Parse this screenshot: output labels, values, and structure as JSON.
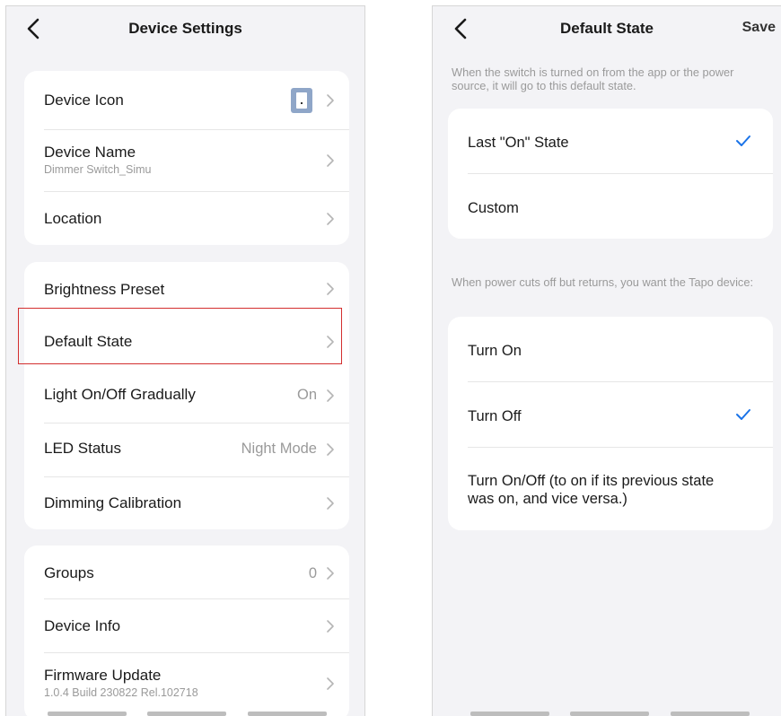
{
  "left_screen": {
    "nav": {
      "title": "Device Settings"
    },
    "groups": [
      {
        "rows": [
          {
            "label": "Device Icon",
            "sublabel": "",
            "value": ""
          },
          {
            "label": "Device Name",
            "sublabel": "Dimmer Switch_Simu",
            "value": ""
          },
          {
            "label": "Location",
            "sublabel": "",
            "value": ""
          }
        ]
      },
      {
        "rows": [
          {
            "label": "Brightness Preset",
            "sublabel": "",
            "value": ""
          },
          {
            "label": "Default State",
            "sublabel": "",
            "value": ""
          },
          {
            "label": "Light On/Off Gradually",
            "sublabel": "",
            "value": "On"
          },
          {
            "label": "LED Status",
            "sublabel": "",
            "value": "Night Mode"
          },
          {
            "label": "Dimming Calibration",
            "sublabel": "",
            "value": ""
          }
        ]
      },
      {
        "rows": [
          {
            "label": "Groups",
            "sublabel": "",
            "value": "0"
          },
          {
            "label": "Device Info",
            "sublabel": "",
            "value": ""
          },
          {
            "label": "Firmware Update",
            "sublabel": "1.0.4 Build 230822 Rel.102718",
            "value": ""
          }
        ]
      }
    ]
  },
  "right_screen": {
    "nav": {
      "title": "Default State",
      "save_label": "Save"
    },
    "hint_1": "When the switch is turned on from the app or the power source, it will go to this default state.",
    "default_options": [
      {
        "label": "Last \"On\" State",
        "selected": true
      },
      {
        "label": "Custom",
        "selected": false
      }
    ],
    "hint_2": "When power cuts off but returns, you want the Tapo device:",
    "power_options": [
      {
        "label": "Turn On",
        "selected": false
      },
      {
        "label": "Turn Off",
        "selected": true
      },
      {
        "label": "Turn On/Off (to on if its previous state was on, and vice versa.)",
        "selected": false
      }
    ]
  },
  "colors": {
    "accent": "#1a73e8",
    "highlight": "#d32f2f",
    "background": "#f3f3f6",
    "card": "#ffffff",
    "secondary_text": "#9a9a9a"
  },
  "icons": {
    "back": "chevron-left-icon",
    "row_arrow": "chevron-right-icon",
    "selected": "checkmark-icon",
    "device": "switch-device-icon"
  }
}
